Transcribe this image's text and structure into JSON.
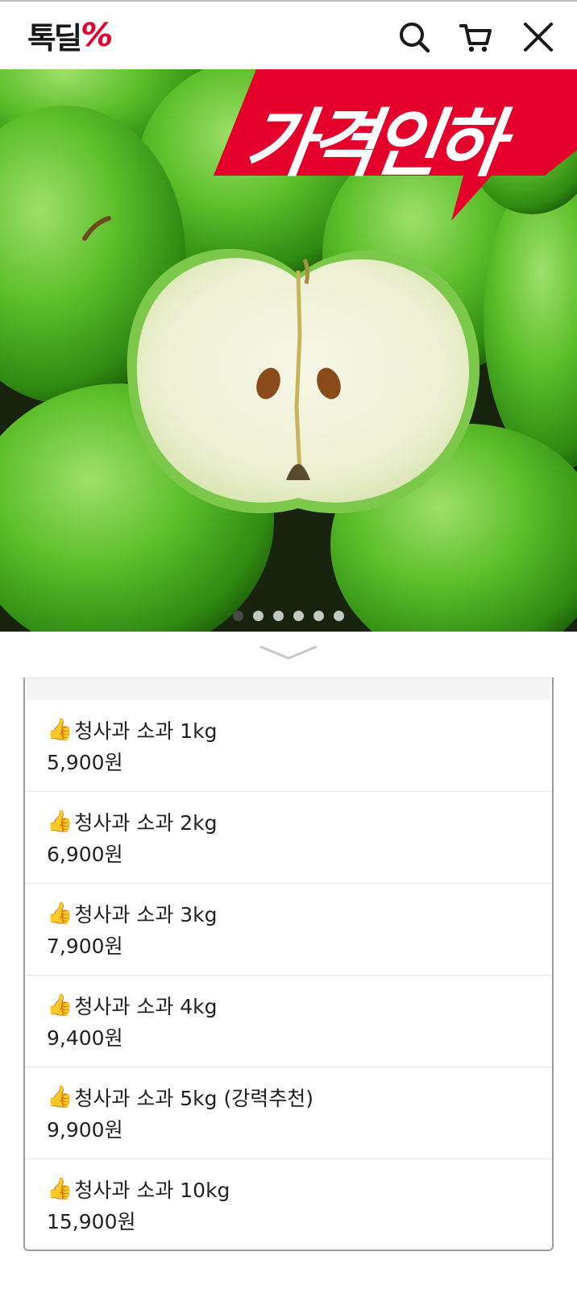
{
  "header": {
    "logo_text": "톡딜",
    "logo_mark": "%",
    "icons": [
      "search-icon",
      "cart-icon",
      "close-icon"
    ]
  },
  "hero": {
    "promo_badge": "가격인하",
    "badge_color": "#e4002b",
    "slide_count": 6,
    "active_slide": 1
  },
  "options": [
    {
      "icon": "👍",
      "name": "청사과 소과 1kg",
      "price": "5,900원"
    },
    {
      "icon": "👍",
      "name": "청사과 소과 2kg",
      "price": "6,900원"
    },
    {
      "icon": "👍",
      "name": "청사과 소과 3kg",
      "price": "7,900원"
    },
    {
      "icon": "👍",
      "name": "청사과 소과 4kg",
      "price": "9,400원"
    },
    {
      "icon": "👍",
      "name": "청사과 소과 5kg (강력추천)",
      "price": "9,900원"
    },
    {
      "icon": "👍",
      "name": "청사과 소과 10kg",
      "price": "15,900원"
    }
  ]
}
